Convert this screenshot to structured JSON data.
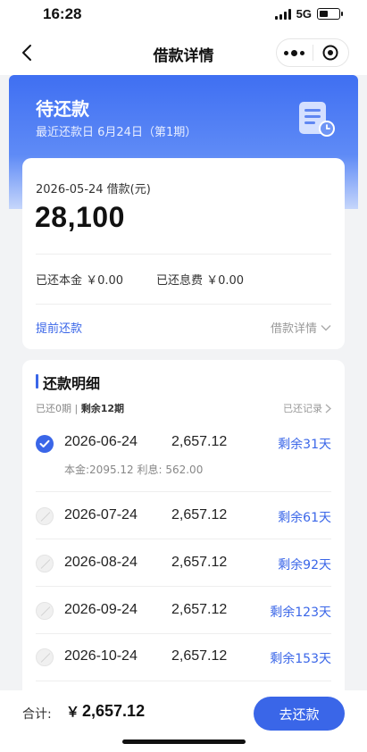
{
  "status_bar": {
    "time": "16:28",
    "network": "5G",
    "battery_level": 0.45
  },
  "nav": {
    "title": "借款详情",
    "back_icon": "chevron-left-icon",
    "more_icon": "more-dots-icon",
    "close_icon": "target-circle-icon"
  },
  "hero": {
    "title": "待还款",
    "subtitle": "最近还款日 6月24日（第1期）",
    "icon": "bill-clock-icon",
    "accent": "#3f6ff2"
  },
  "summary": {
    "loan_date": "2026-05-24 借款(元)",
    "amount": "28,100",
    "paid_principal": "已还本金 ￥0.00",
    "paid_interest": "已还息费 ￥0.00",
    "prepay_label": "提前还款",
    "detail_label": "借款详情"
  },
  "schedule": {
    "title": "还款明细",
    "paid_count": "已还0期",
    "separator": " | ",
    "remaining_count": "剩余12期",
    "records_label": "已还记录",
    "rows": [
      {
        "date": "2026-06-24",
        "amount": "2,657.12",
        "remain": "剩余31天",
        "sub": "本金:2095.12  利息: 562.00",
        "checked": true
      },
      {
        "date": "2026-07-24",
        "amount": "2,657.12",
        "remain": "剩余61天",
        "checked": false
      },
      {
        "date": "2026-08-24",
        "amount": "2,657.12",
        "remain": "剩余92天",
        "checked": false
      },
      {
        "date": "2026-09-24",
        "amount": "2,657.12",
        "remain": "剩余123天",
        "checked": false
      },
      {
        "date": "2026-10-24",
        "amount": "2,657.12",
        "remain": "剩余153天",
        "checked": false
      }
    ]
  },
  "footer": {
    "total_label": "合计:",
    "currency": "￥",
    "total_value": "2,657.12",
    "pay_label": "去还款",
    "accent": "#3a66e8"
  }
}
